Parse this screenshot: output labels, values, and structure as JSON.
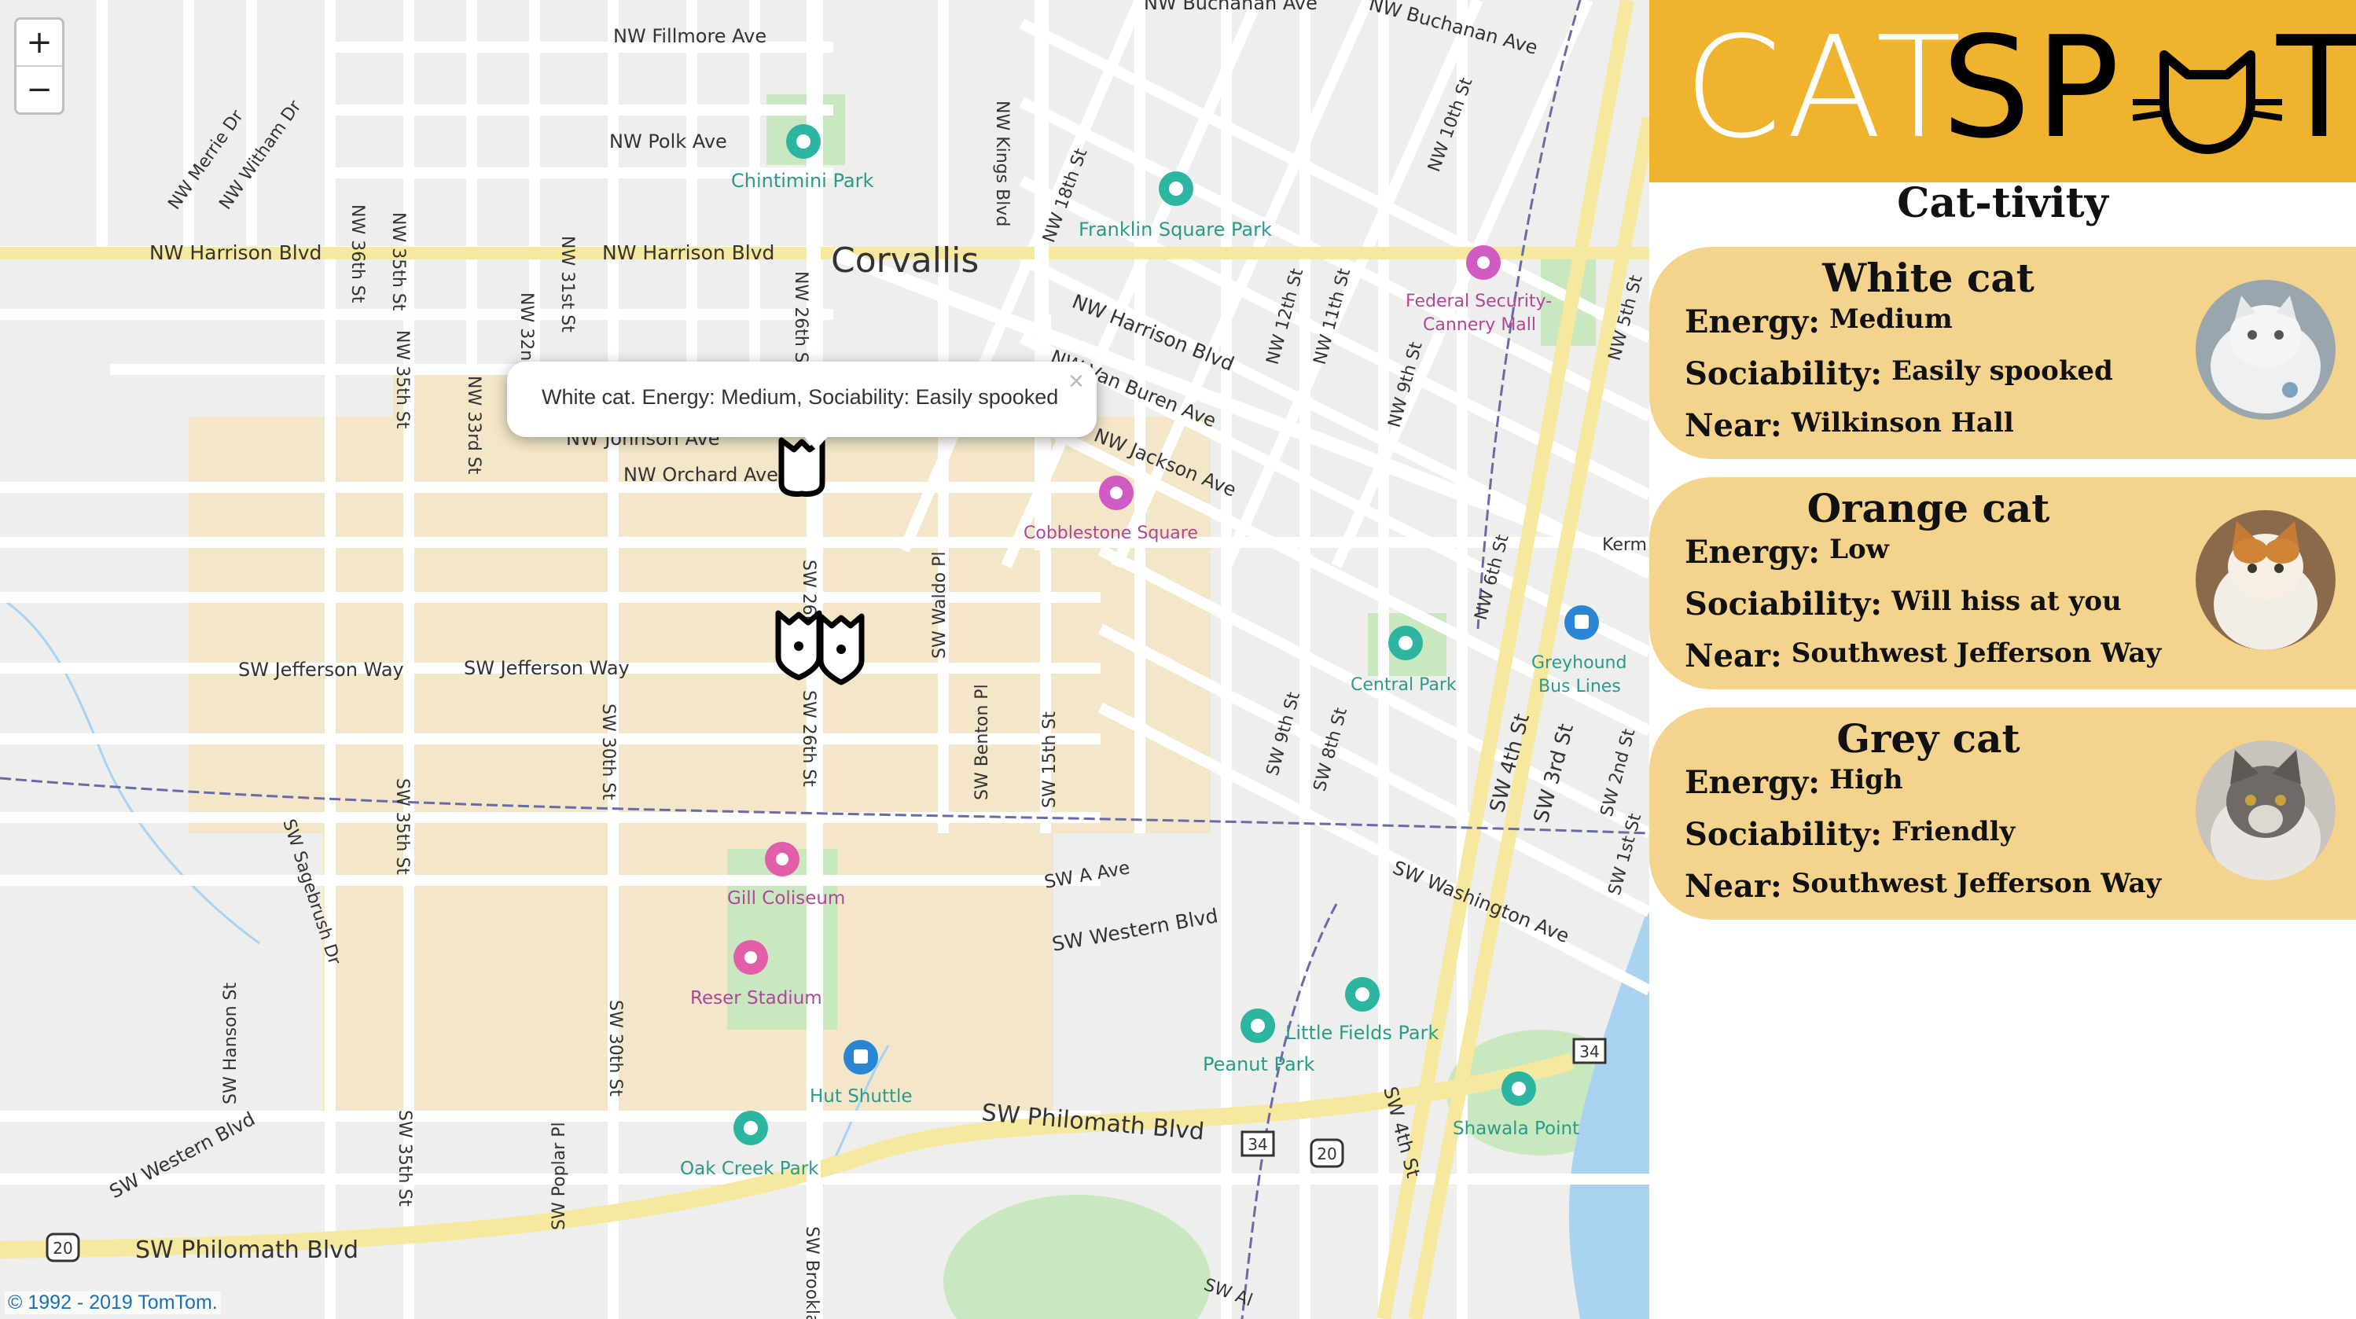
{
  "map": {
    "zoom_in_label": "+",
    "zoom_out_label": "−",
    "attribution": "© 1992 - 2019 TomTom.",
    "popup": {
      "text": "White cat. Energy: Medium, Sociability: Easily spooked",
      "close_label": "×"
    },
    "labels": {
      "nw_buchanan_1": "NW Buchanan Ave",
      "nw_buchanan_2": "NW Buchanan Ave",
      "nw_fillmore": "NW Fillmore Ave",
      "nw_polk": "NW Polk Ave",
      "chintimini": "Chintimini Park",
      "nw_merrie": "NW Merrie Dr",
      "nw_witham": "NW Witham Dr",
      "nw_36th": "NW 36th St",
      "nw_35th_top": "NW 35th St",
      "nw_harrison_left": "NW Harrison Blvd",
      "nw_harrison_mid": "NW Harrison Blvd",
      "corvallis": "Corvallis",
      "nw_kings": "NW Kings Blvd",
      "nw_18th": "NW 18th St",
      "franklin": "Franklin Square Park",
      "nw_10th": "NW 10th St",
      "nw_harrison_right": "NW Harrison Blvd",
      "nw_12th": "NW 12th St",
      "nw_11th": "NW 11th St",
      "federal": "Federal Security-",
      "cannery": "Cannery Mall",
      "nw_5th": "NW 5th St",
      "nw_9th": "NW 9th St",
      "nw_van_buren": "NW Van Buren Ave",
      "nw_jackson": "NW Jackson Ave",
      "cobblestone": "Cobblestone Square",
      "nw_31st": "NW 31st St",
      "nw_32nd": "NW 32nd",
      "nw_26th": "NW 26th St",
      "nw_35th": "NW 35th St",
      "nw_33rd": "NW 33rd St",
      "nw_johnson": "NW Johnson Ave",
      "nw_orchard": "NW Orchard Ave",
      "sw_26th_top": "SW 26th St",
      "sw_waldo": "SW Waldo Pl",
      "nw_6th": "NW 6th St",
      "kerm": "Kerm",
      "greyhound_1": "Greyhound",
      "greyhound_2": "Bus Lines",
      "central": "Central Park",
      "sw_jefferson_left": "SW Jefferson Way",
      "sw_jefferson_mid": "SW Jefferson Way",
      "sw_30th": "SW 30th St",
      "sw_26th": "SW 26th St",
      "sw_benton": "SW Benton Pl",
      "sw_15th": "SW 15th St",
      "sw_9th": "SW 9th St",
      "sw_8th": "SW 8th St",
      "sw_4th": "SW 4th St",
      "sw_3rd": "SW 3rd St",
      "sw_2nd": "SW 2nd St",
      "sw_1st": "SW 1st St",
      "sw_35th": "SW 35th St",
      "sw_sagebrush": "SW Sagebrush Dr",
      "gill": "Gill Coliseum",
      "sw_a": "SW A Ave",
      "sw_washington": "SW Washington Ave",
      "sw_western_right": "SW Western Blvd",
      "reser": "Reser Stadium",
      "sw_hanson": "SW Hanson St",
      "sw_30th_bottom": "SW 30th St",
      "hut": "Hut Shuttle",
      "little_fields": "Little Fields Park",
      "peanut": "Peanut Park",
      "sw_philomath_right": "SW Philomath Blvd",
      "sw_4th_bottom": "SW 4th St",
      "shawala": "Shawala Point",
      "sw_western_left": "SW Western Blvd",
      "sw_35th_bottom": "SW 35th St",
      "sw_poplar": "SW Poplar Pl",
      "oak_creek": "Oak Creek Park",
      "sw_philomath_left": "SW Philomath Blvd",
      "sw_brooklane": "SW Brookla",
      "sw_al": "SW Al",
      "shield_34a": "34",
      "shield_20a": "20",
      "shield_34b": "34",
      "shield_20b": "20"
    }
  },
  "panel": {
    "logo": {
      "cat": "CAT",
      "sp": "SP",
      "t": "T"
    },
    "title": "Cat-tivity",
    "field_labels": {
      "energy": "Energy:",
      "sociability": "Sociability:",
      "near": "Near:"
    },
    "cats": [
      {
        "name": "White cat",
        "energy": "Medium",
        "sociability": "Easily spooked",
        "near": "Wilkinson Hall"
      },
      {
        "name": "Orange cat",
        "energy": "Low",
        "sociability": "Will hiss at you",
        "near": "Southwest Jefferson Way"
      },
      {
        "name": "Grey cat",
        "energy": "High",
        "sociability": "Friendly",
        "near": "Southwest Jefferson Way"
      }
    ]
  },
  "colors": {
    "header": "#f0b32d",
    "card": "#f4d48c",
    "campus": "#f3e6c9",
    "park": "#c9e8c0",
    "water": "#a9d3f0",
    "highway": "#f7e8a0"
  }
}
